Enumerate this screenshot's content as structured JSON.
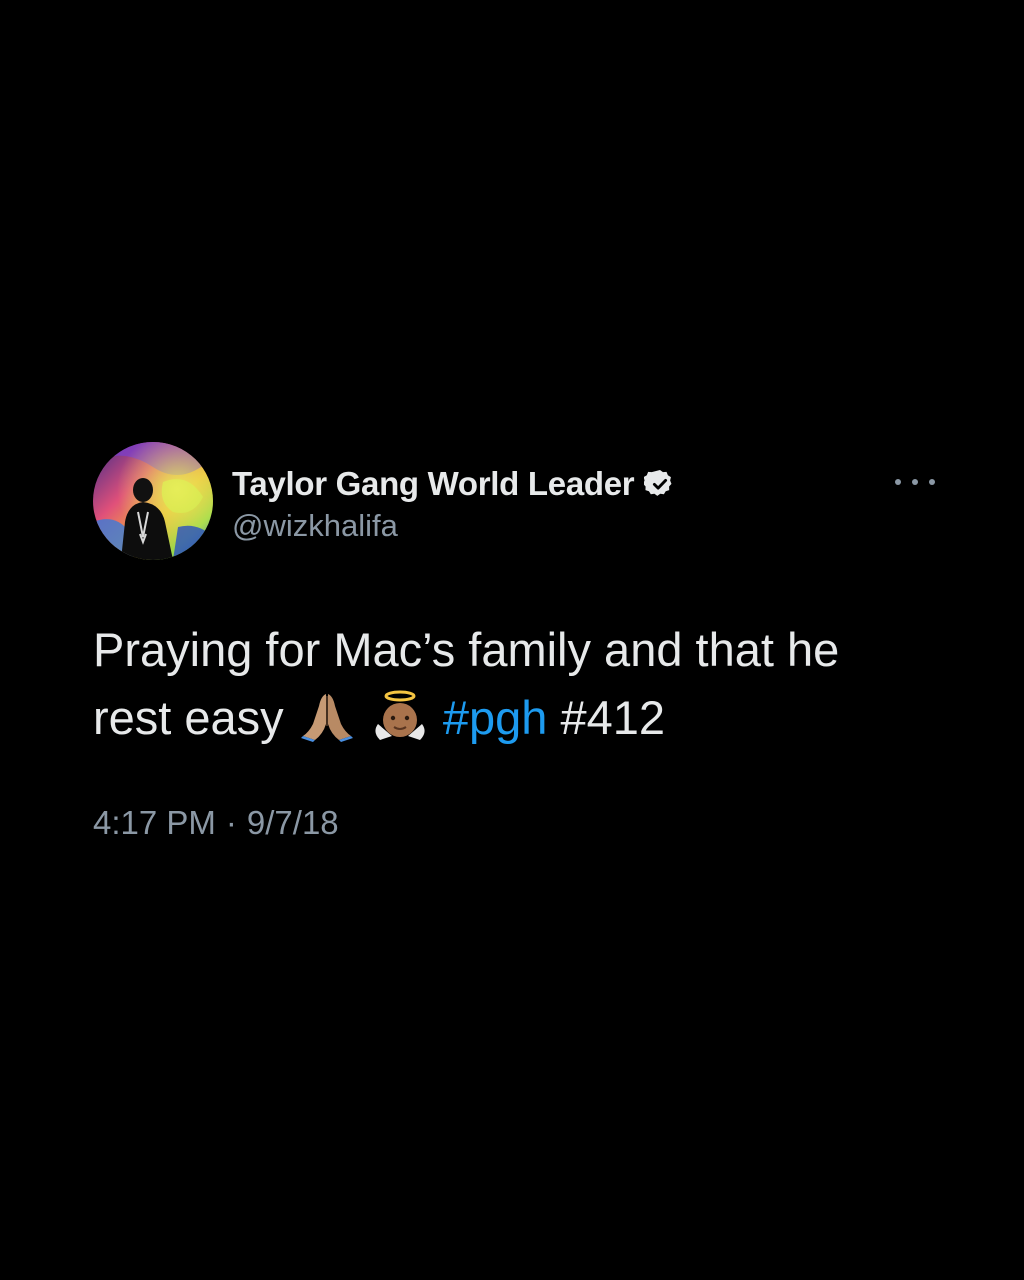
{
  "tweet": {
    "display_name": "Taylor Gang World Leader",
    "handle": "@wizkhalifa",
    "text_line1": "Praying for Mac’s family and that he",
    "text_line2_prefix": "rest easy",
    "emojis": [
      "folded-hands-emoji",
      "baby-angel-emoji"
    ],
    "hashtag_link": "#pgh",
    "hashtag_plain": "#412",
    "time": "4:17 PM",
    "date": "9/7/18",
    "separator": "·"
  },
  "colors": {
    "background": "#000000",
    "primary_text": "#e7e9ea",
    "secondary_text": "#8b98a5",
    "link": "#1d9bf0"
  },
  "icons": {
    "verified": "verified-badge-icon",
    "more": "more-options-icon"
  }
}
